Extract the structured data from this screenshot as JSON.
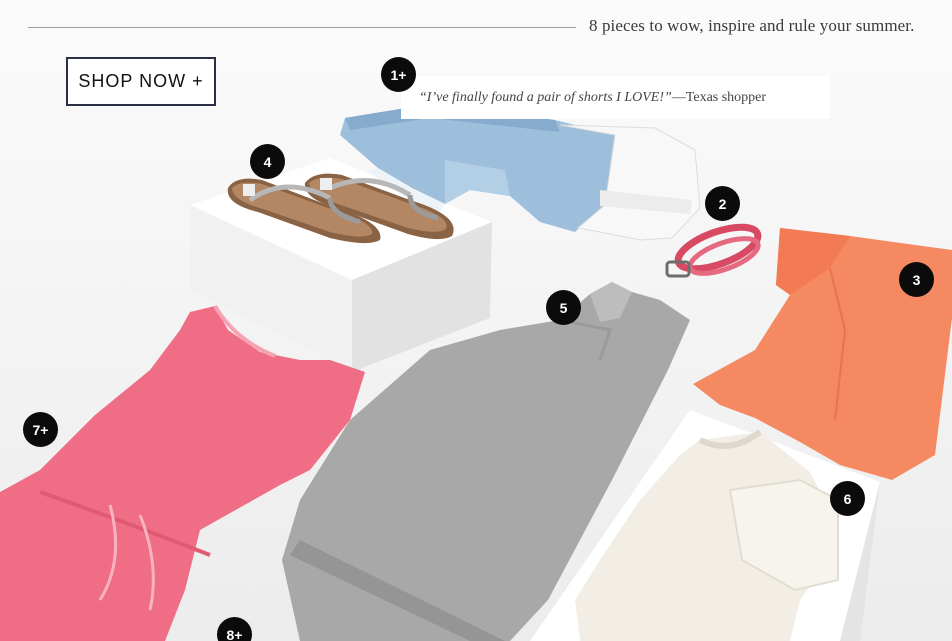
{
  "header": {
    "tagline": "8 pieces to wow, inspire and rule your summer."
  },
  "cta": {
    "shop_now_label": "SHOP NOW +"
  },
  "testimonial": {
    "quote": "“I’ve finally found a pair of shorts I LOVE!”",
    "attribution": " —Texas shopper"
  },
  "badges": {
    "item1": "1+",
    "item2": "2",
    "item3": "3",
    "item4": "4",
    "item5": "5",
    "item6": "6",
    "item7": "7+",
    "item8": "8+"
  },
  "colors": {
    "background": "#f3f3f3",
    "badge": "#0b0b0b",
    "button_border": "#2a2f45",
    "tee_orange": "#f58a62",
    "romper_pink": "#ef6e86",
    "dress_grey": "#a8a8a8",
    "denim": "#9dbfdc",
    "belt_pink": "#d84a64"
  },
  "icons": {
    "product_badge": "numbered-circle-icon"
  }
}
